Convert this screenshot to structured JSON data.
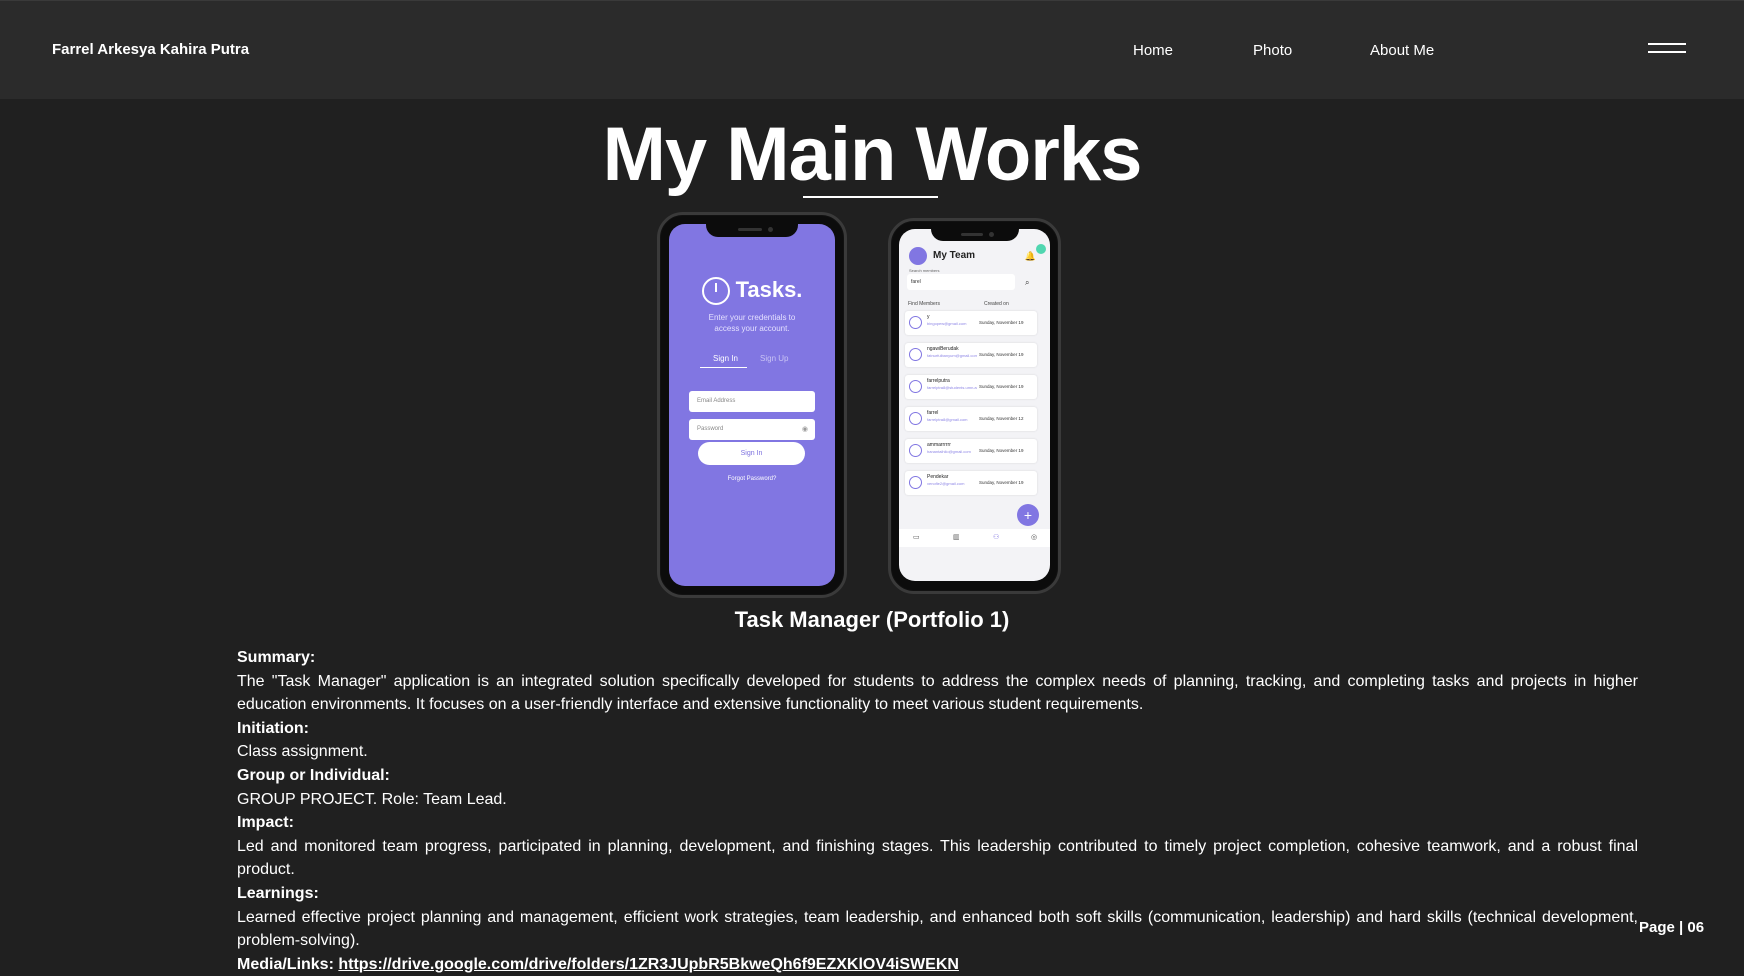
{
  "header": {
    "brand": "Farrel Arkesya Kahira Putra",
    "nav": [
      "Home",
      "Photo",
      "About Me"
    ],
    "menu_icon": "hamburger-icon"
  },
  "page_title": "My Main Works",
  "mockups": {
    "login_screen": {
      "app_name": "Tasks.",
      "subtitle_line1": "Enter your credentials to",
      "subtitle_line2": "access your account.",
      "tab_signin": "Sign In",
      "tab_signup": "Sign Up",
      "email_placeholder": "Email Address",
      "password_placeholder": "Password",
      "signin_button": "Sign In",
      "forgot": "Forgot Password?"
    },
    "team_screen": {
      "title": "My Team",
      "search_label": "Search members",
      "search_value": "farel",
      "col_find": "Find Members",
      "col_created": "Created on",
      "members": [
        {
          "name": "y",
          "email": "bingopew@gmail.com",
          "date": "Sunday, November 19"
        },
        {
          "name": "ngawiBerudak",
          "email": "fatnurfulbanyum@gmail.com",
          "date": "Sunday, November 19"
        },
        {
          "name": "farrelputra",
          "email": "farrelptra8@students.umn.ac.id",
          "date": "Sunday, November 19"
        },
        {
          "name": "farrel",
          "email": "farrelptra8@gmail.com",
          "date": "Sunday, November 12"
        },
        {
          "name": "ammarrrrrr",
          "email": "hanantaihilo@gmail.com",
          "date": "Sunday, November 19"
        },
        {
          "name": "Pendekar",
          "email": "xenofie2@gmail.com",
          "date": "Sunday, November 19"
        }
      ],
      "fab": "+"
    }
  },
  "caption": "Task Manager (Portfolio 1)",
  "sections": {
    "summary_h": "Summary:",
    "summary": "The \"Task Manager\" application is an integrated solution specifically developed for students to address the complex needs of planning, tracking, and completing tasks and projects in higher education environments. It focuses on a user-friendly interface and extensive functionality to meet various student requirements.",
    "initiation_h": "Initiation:",
    "initiation": "Class assignment.",
    "group_h": "Group or Individual:",
    "group": "GROUP PROJECT. Role: Team Lead.",
    "impact_h": "Impact:",
    "impact": "Led and monitored team progress, participated in planning, development, and finishing stages. This leadership contributed to timely project completion, cohesive teamwork, and a robust final product.",
    "learnings_h": "Learnings:",
    "learnings": "Learned effective project planning and management, efficient work strategies, team leadership, and enhanced both soft skills (communication, leadership) and hard skills (technical development, problem-solving).",
    "media_h": "Media/Links:",
    "media_link": "https://drive.google.com/drive/folders/1ZR3JUpbR5BkweQh6f9EZXKlOV4iSWEKN"
  },
  "page_number": "Page | 06"
}
